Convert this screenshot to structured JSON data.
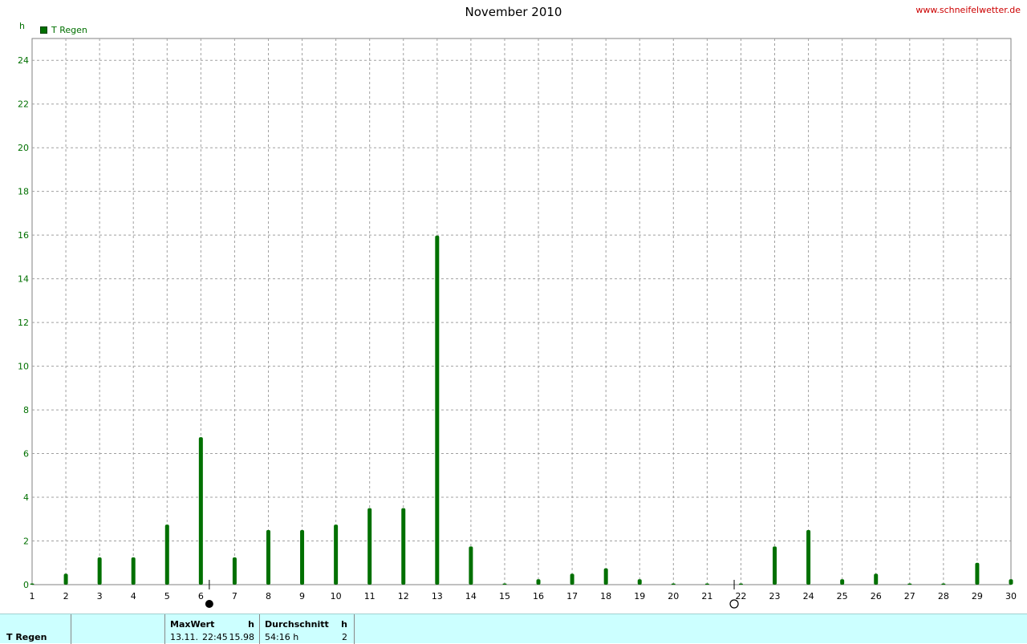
{
  "header": {
    "title": "November 2010",
    "website": "www.schneifelwetter.de",
    "unit": "h",
    "legend_label": "T Regen"
  },
  "colors": {
    "series": "#007000",
    "grid": "#a0a0a0",
    "footer_bg": "#ccffff"
  },
  "chart_data": {
    "type": "bar",
    "series": [
      {
        "name": "T Regen",
        "x": [
          1,
          2,
          3,
          4,
          5,
          6,
          7,
          8,
          9,
          10,
          11,
          12,
          13,
          14,
          15,
          16,
          17,
          18,
          19,
          20,
          21,
          22,
          23,
          24,
          25,
          26,
          27,
          28,
          29,
          30
        ],
        "values": [
          0,
          0.5,
          1.25,
          1.25,
          2.75,
          6.75,
          1.25,
          2.5,
          2.5,
          2.75,
          3.5,
          3.5,
          15.98,
          1.75,
          0,
          0.25,
          0.5,
          0.75,
          0.25,
          0,
          0,
          0,
          1.75,
          2.5,
          0.25,
          0.5,
          0,
          0,
          1,
          0.25
        ]
      }
    ],
    "xticks": [
      "1",
      "2",
      "3",
      "4",
      "5",
      "6",
      "7",
      "8",
      "9",
      "10",
      "11",
      "12",
      "13",
      "14",
      "15",
      "16",
      "17",
      "18",
      "19",
      "20",
      "21",
      "22",
      "23",
      "24",
      "25",
      "26",
      "27",
      "28",
      "29",
      "30"
    ],
    "yticks": [
      "0",
      "2",
      "4",
      "6",
      "8",
      "10",
      "12",
      "14",
      "16",
      "18",
      "20",
      "22",
      "24"
    ],
    "xlim": [
      1,
      30
    ],
    "ylim": [
      0,
      25
    ],
    "ylabel": "h",
    "grid": true,
    "legend": "top-left",
    "moon_phases": [
      {
        "phase": "new",
        "day": 6.25
      },
      {
        "phase": "full",
        "day": 21.8
      }
    ]
  },
  "footer": {
    "row_label": "T Regen",
    "max_header": "MaxWert",
    "max_unit": "h",
    "max_date": "13.11.",
    "max_time": "22:45",
    "max_value": "15.98",
    "avg_header": "Durchschnitt",
    "avg_unit": "h",
    "avg_value": "54:16 h",
    "avg_count": "2"
  }
}
